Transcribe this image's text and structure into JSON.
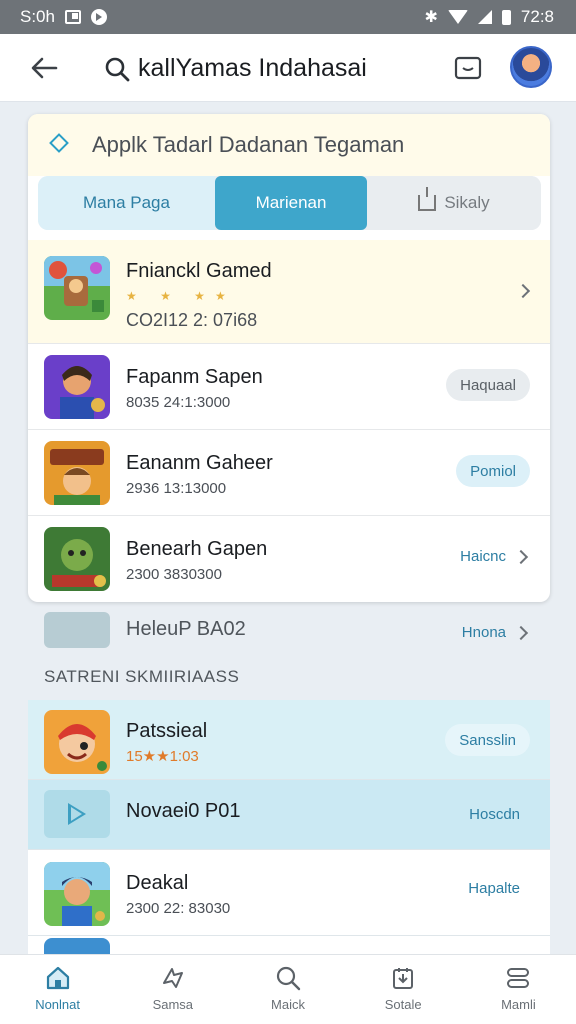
{
  "status_bar": {
    "time_left": "S:0h",
    "time_right": "72:8"
  },
  "header": {
    "search_text": "kallYamas Indahasai"
  },
  "card": {
    "title": "Applk Tadarl Dadanan Tegaman",
    "tabs": [
      {
        "label": "Mana Paga"
      },
      {
        "label": "Marienan"
      },
      {
        "label": "Sikaly"
      }
    ],
    "items": [
      {
        "title": "Fnianckl Gamed",
        "meta": "CO2I12 2: 07i68",
        "stars": "★ ★ ★★"
      },
      {
        "title": "Fapanm Sapen",
        "meta": "8035 24:1:3000",
        "action": "Haquaal"
      },
      {
        "title": "Eananm Gaheer",
        "meta": "2936 13:13000",
        "action": "Pomiol"
      },
      {
        "title": "Benearh Gapen",
        "meta": "2300 3830300",
        "action": "Haicnc"
      }
    ]
  },
  "misc_row": {
    "title": "HeleuP BA02",
    "action": "Hnona"
  },
  "section_label": "SATRENI SKMIIRIAASS",
  "list": [
    {
      "title": "Patssieal",
      "meta": "15★★1:03",
      "action": "Sansslin"
    },
    {
      "title": "Novaei0 P01",
      "action": "Hoscdn"
    },
    {
      "title": "Deakal",
      "meta": "2300 22: 83030",
      "action": "Hapalte"
    }
  ],
  "bottom_nav": [
    {
      "label": "Nonlnat"
    },
    {
      "label": "Samsa"
    },
    {
      "label": "Maick"
    },
    {
      "label": "Sotale"
    },
    {
      "label": "Mamli"
    }
  ],
  "colors": {
    "accent": "#3ea6cb",
    "accent_text": "#2d7ea3",
    "highlight": "#fffbe8"
  }
}
